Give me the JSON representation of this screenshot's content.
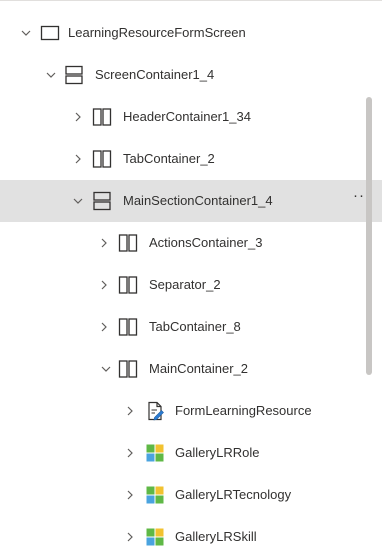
{
  "tree": {
    "items": [
      {
        "label": "LearningResourceFormScreen",
        "icon": "screen-icon",
        "expanded": true
      },
      {
        "label": "ScreenContainer1_4",
        "icon": "vertical-container-icon",
        "expanded": true
      },
      {
        "label": "HeaderContainer1_34",
        "icon": "horizontal-container-icon",
        "expanded": false
      },
      {
        "label": "TabContainer_2",
        "icon": "horizontal-container-icon",
        "expanded": false
      },
      {
        "label": "MainSectionContainer1_4",
        "icon": "vertical-container-icon",
        "expanded": true,
        "selected": true
      },
      {
        "label": "ActionsContainer_3",
        "icon": "horizontal-container-icon",
        "expanded": false
      },
      {
        "label": "Separator_2",
        "icon": "horizontal-container-icon",
        "expanded": false
      },
      {
        "label": "TabContainer_8",
        "icon": "horizontal-container-icon",
        "expanded": false
      },
      {
        "label": "MainContainer_2",
        "icon": "horizontal-container-icon",
        "expanded": true
      },
      {
        "label": "FormLearningResource",
        "icon": "form-icon",
        "expanded": false
      },
      {
        "label": "GalleryLRRole",
        "icon": "gallery-icon",
        "expanded": false
      },
      {
        "label": "GalleryLRTecnology",
        "icon": "gallery-icon",
        "expanded": false
      },
      {
        "label": "GalleryLRSkill",
        "icon": "gallery-icon",
        "expanded": false
      }
    ],
    "more_label": "···"
  },
  "colors": {
    "selected_bg": "#e1e1e1",
    "text": "#323130",
    "gallery_green": "#5fb846",
    "gallery_yellow": "#f2c230",
    "gallery_blue": "#4aa3df",
    "form_blue": "#2b7cd3"
  }
}
